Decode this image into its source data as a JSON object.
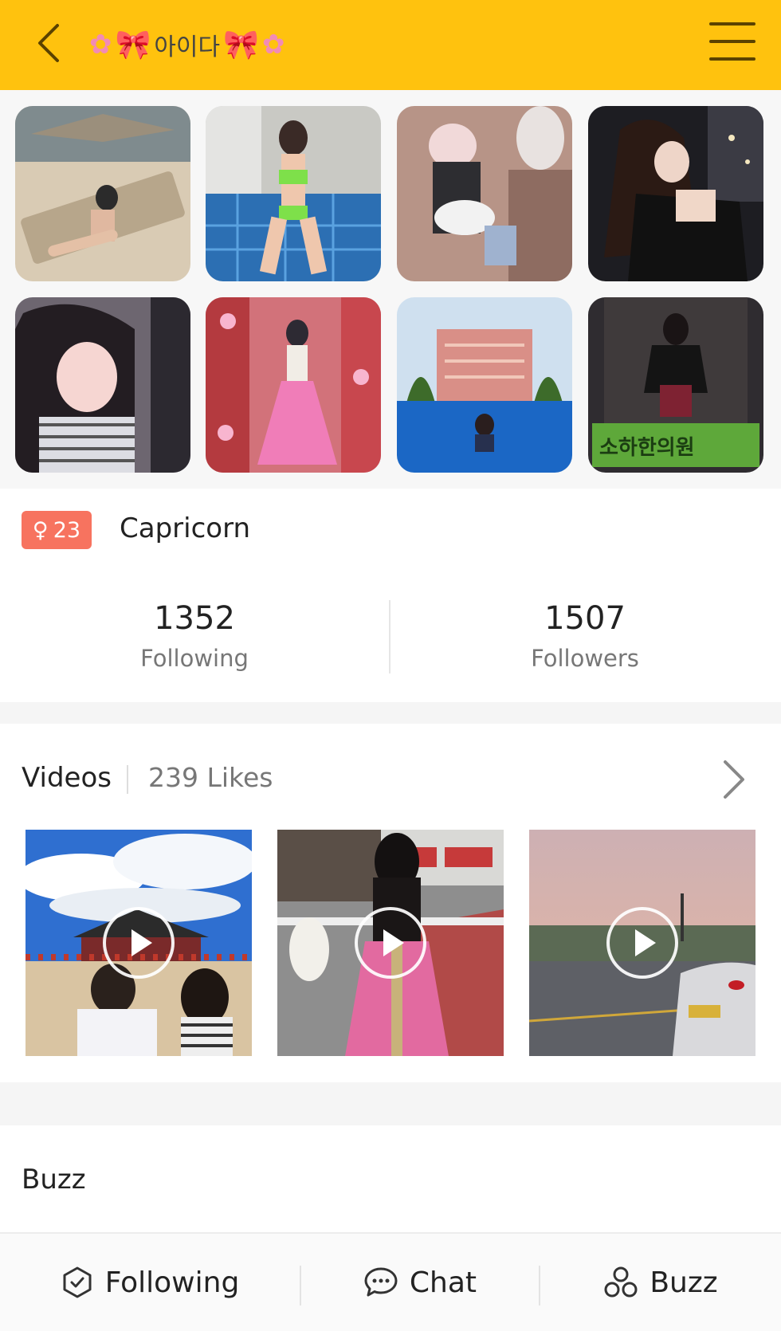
{
  "header": {
    "title_text": "아이다",
    "flower_glyph": "✿",
    "bow_glyph": "🎀",
    "back_icon": "chevron-left-icon",
    "menu_icon": "hamburger-menu-icon",
    "bar_color": "#FFC20E"
  },
  "photos": [
    {
      "alt": "beach-lounger"
    },
    {
      "alt": "green-bikini-pool"
    },
    {
      "alt": "airplane-seat"
    },
    {
      "alt": "city-night"
    },
    {
      "alt": "selfie"
    },
    {
      "alt": "hanbok-pink"
    },
    {
      "alt": "resort-pool"
    },
    {
      "alt": "elevator-mirror",
      "overlay_text": "소하한의원"
    }
  ],
  "profile": {
    "gender_symbol": "♀",
    "age": "23",
    "zodiac": "Capricorn",
    "following_count": "1352",
    "following_label": "Following",
    "followers_count": "1507",
    "followers_label": "Followers",
    "badge_color": "#f7735f"
  },
  "videos": {
    "title": "Videos",
    "likes": "239 Likes",
    "items": [
      {
        "alt": "palace-clouds"
      },
      {
        "alt": "hanbok-street"
      },
      {
        "alt": "car-sunset"
      }
    ]
  },
  "buzz": {
    "title": "Buzz"
  },
  "bottom_bar": {
    "following_label": "Following",
    "chat_label": "Chat",
    "buzz_label": "Buzz"
  }
}
